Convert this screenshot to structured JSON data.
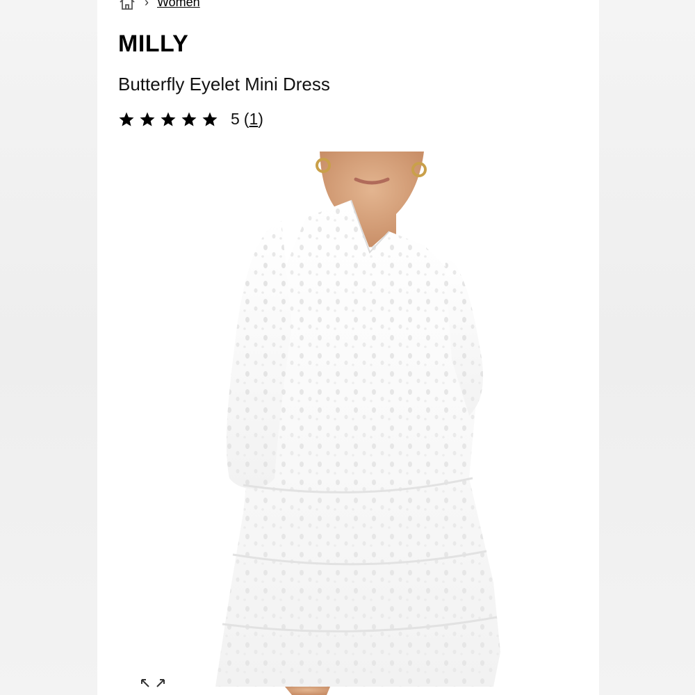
{
  "breadcrumb": {
    "home_icon": "home-icon",
    "separator": "›",
    "current": "Women"
  },
  "product": {
    "brand": "MILLY",
    "name": "Butterfly Eyelet Mini Dress",
    "rating": {
      "stars": 5,
      "max_stars": 5,
      "value_label": "5",
      "count_open": "(",
      "count": "1",
      "count_close": ")"
    },
    "image_icon": "expand-icon"
  },
  "colors": {
    "page_bg": "#ffffff",
    "side_bg": "#f0f0f0",
    "text": "#000000"
  }
}
